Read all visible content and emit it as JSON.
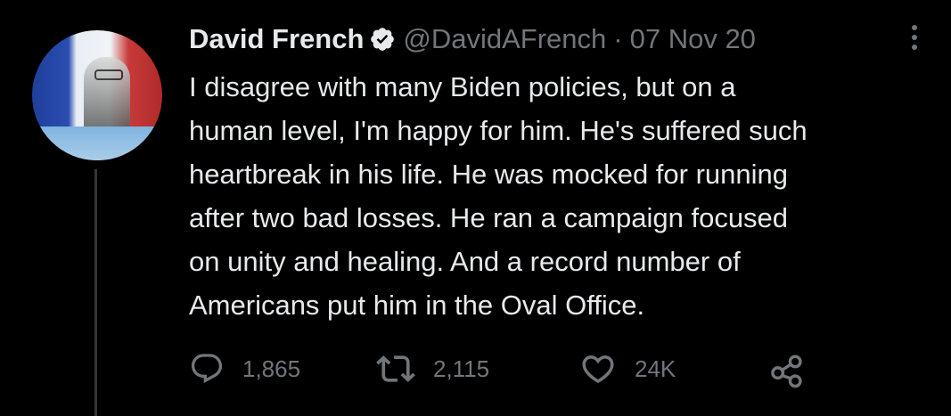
{
  "tweet": {
    "author_name": "David French",
    "handle": "@DavidAFrench",
    "separator": "·",
    "date": "07 Nov 20",
    "verified": true,
    "text_lines": [
      "I disagree with many Biden policies, but on a",
      "human level, I'm happy for him. He's suffered such",
      "heartbreak in his life. He was mocked for running",
      "after two bad losses. He ran a campaign focused",
      "on unity and healing. And a record number of",
      "Americans put him in the Oval Office."
    ],
    "stats": {
      "replies": "1,865",
      "retweets": "2,115",
      "likes": "24K"
    }
  },
  "colors": {
    "background": "#000000",
    "primary_text": "#e7e9ea",
    "secondary_text": "#71767b",
    "thread_line": "#333639",
    "verified_badge": "#e7e9ea"
  },
  "icons": {
    "verified": "verified-badge-icon",
    "more": "more-options-icon",
    "reply": "reply-icon",
    "retweet": "retweet-icon",
    "like": "heart-icon",
    "share": "share-icon"
  }
}
